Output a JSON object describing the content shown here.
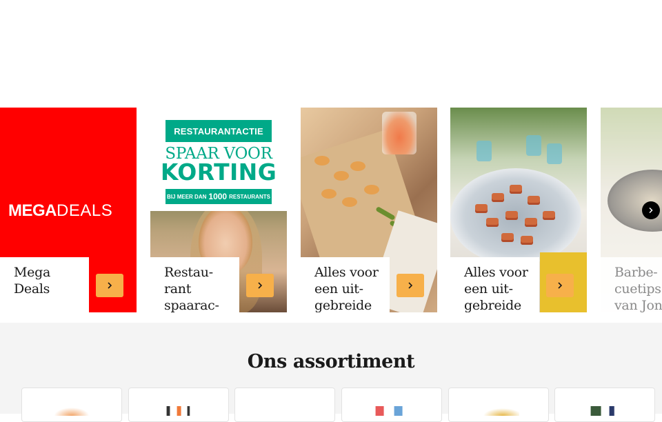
{
  "carousel": {
    "cards": [
      {
        "id": "mega-deals",
        "caption": "Mega Deals",
        "logo_bold": "MEGA",
        "logo_thin": "DEALS",
        "accent": "#ff0000"
      },
      {
        "id": "restaurant",
        "caption": "Restau-rant spaarac-tie",
        "banner_tag": "RESTAURANTACTIE",
        "banner_line1": "SPAAR VOOR",
        "banner_line2": "KORTING",
        "banner_small_left": "BIJ MEER DAN",
        "banner_small_num": "1000",
        "banner_small_right": "RESTAURANTS",
        "accent": "#00a988"
      },
      {
        "id": "zomer",
        "caption": "Alles voor een uit-gebreide zomer-"
      },
      {
        "id": "dinner",
        "caption": "Alles voor een uit-gebreide dinner-"
      },
      {
        "id": "barbecue",
        "caption": "Barbe-cuetips van Jon Althuis"
      }
    ],
    "button_color": "#f7b04a",
    "next_label": "Volgende"
  },
  "assortment": {
    "title": "Ons assortiment",
    "tiles": [
      "categorie-1",
      "categorie-2",
      "categorie-3",
      "categorie-4",
      "categorie-5",
      "categorie-6"
    ]
  }
}
